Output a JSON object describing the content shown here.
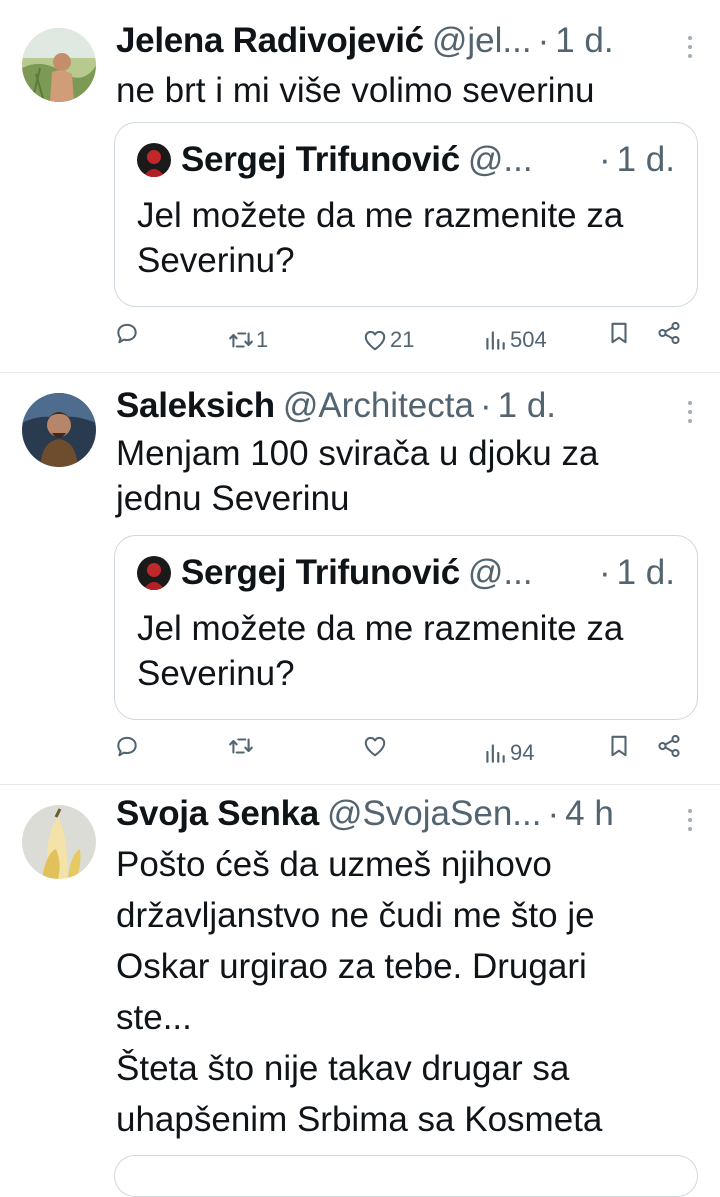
{
  "tweets": [
    {
      "author": "Jelena Radivojević",
      "handle": "@jel...",
      "time": "1 d.",
      "text": "ne brt i mi više volimo severinu",
      "quote": {
        "author": "Sergej Trifunović",
        "handle": "@...",
        "time": "1 d.",
        "text": "Jel možete da me razmenite za Severinu?"
      },
      "stats": {
        "retweets": "1",
        "likes": "21",
        "views": "504"
      }
    },
    {
      "author": "Saleksich",
      "handle": "@Architecta",
      "time": "1 d.",
      "text": "Menjam 100 svirača u djoku za\njednu Severinu",
      "quote": {
        "author": "Sergej Trifunović",
        "handle": "@...",
        "time": "1 d.",
        "text": "Jel možete da me razmenite za Severinu?"
      },
      "stats": {
        "retweets": "",
        "likes": "",
        "views": "94"
      }
    },
    {
      "author": "Svoja Senka",
      "handle": "@SvojaSen...",
      "time": "4 h",
      "text": "Pošto ćeš da uzmeš njihovo\ndržavljanstvo ne čudi me što je\nOskar urgirao za tebe. Drugari\nste...\nŠteta što nije takav drugar sa\nuhapšenim Srbima sa Kosmeta"
    }
  ],
  "icons": {
    "reply": "reply-icon",
    "retweet": "retweet-icon",
    "like": "heart-icon",
    "views": "views-icon",
    "bookmark": "bookmark-icon",
    "share": "share-icon",
    "more": "more-icon"
  },
  "colors": {
    "text": "#0f1419",
    "secondary": "#536471",
    "border": "#cfd9de",
    "divider": "#e6e9ec"
  }
}
